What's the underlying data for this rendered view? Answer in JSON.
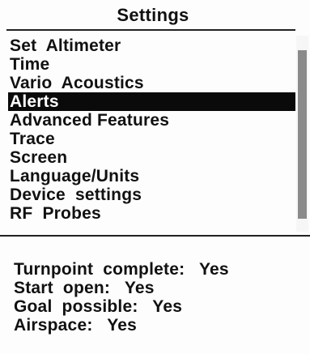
{
  "title": "Settings",
  "menu": {
    "items": [
      {
        "label": "Set  Altimeter",
        "selected": false
      },
      {
        "label": "Time",
        "selected": false
      },
      {
        "label": "Vario  Acoustics",
        "selected": false
      },
      {
        "label": "Alerts",
        "selected": true
      },
      {
        "label": "Advanced Features",
        "selected": false
      },
      {
        "label": "Trace",
        "selected": false
      },
      {
        "label": "Screen",
        "selected": false
      },
      {
        "label": "Language/Units",
        "selected": false
      },
      {
        "label": "Device  settings",
        "selected": false
      },
      {
        "label": "RF  Probes",
        "selected": false
      }
    ]
  },
  "alerts": {
    "rows": [
      {
        "label": "Turnpoint  complete:",
        "value": "Yes"
      },
      {
        "label": "Start  open:",
        "value": "Yes"
      },
      {
        "label": "Goal  possible:",
        "value": "Yes"
      },
      {
        "label": "Airspace:",
        "value": "Yes"
      }
    ]
  },
  "colors": {
    "selection_background": "#0a0a0a",
    "selection_text": "#ffffff",
    "scroll_thumb": "#8a8a8a"
  }
}
